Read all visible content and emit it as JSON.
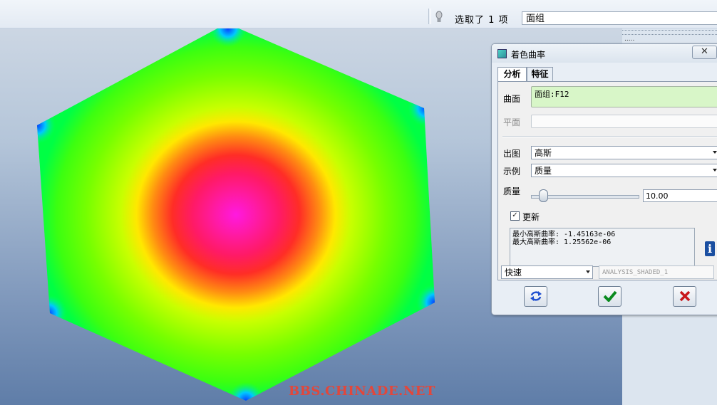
{
  "toolbar": {
    "selection_status": "选取了 1 项",
    "filter_value": "面组"
  },
  "side_panel": {
    "label": "....."
  },
  "watermark": "BBS.CHINADE.NET",
  "dialog": {
    "title": "着色曲率",
    "close_glyph": "✕",
    "tabs": [
      {
        "label": "分析",
        "active": true
      },
      {
        "label": "特征",
        "active": false
      }
    ],
    "surface_label": "曲面",
    "surface_value": "面组:F12",
    "plane_label": "平面",
    "plane_value": "",
    "output_label": "出图",
    "output_value": "高斯",
    "example_label": "示例",
    "example_value": "质量",
    "quality_label": "质量",
    "quality_value": "10.00",
    "update_label": "更新",
    "update_checked": true,
    "update_checkmark": "✓",
    "results": [
      "最小高斯曲率: -1.45163e-06",
      "最大高斯曲率: 1.25562e-06"
    ],
    "info_glyph": "i",
    "mode_value": "快速",
    "analysis_name": "ANALYSIS_SHADED_1",
    "buttons": [
      "repeat-analysis",
      "confirm",
      "cancel"
    ]
  },
  "colors": {
    "ok_green": "#0a8a1e",
    "cancel_red": "#c8171b",
    "repeat_blue": "#1f4fd0",
    "surface_field_bg": "#d8f6c8"
  }
}
